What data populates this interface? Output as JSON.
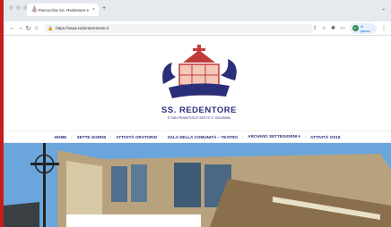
{
  "browser": {
    "tab_title": "Parrocchia SS. Redentore e S...",
    "tab_close": "×",
    "new_tab": "+",
    "url": "https://www.redentoresesto.it",
    "profile_initial": "P",
    "profile_status": "In pausa"
  },
  "site": {
    "title": "SS. REDENTORE",
    "subtitle": "E SAN FRANCESCO SESTO S. GIOVANNI"
  },
  "nav": {
    "items": [
      {
        "label": "HOME"
      },
      {
        "label": "SETTE GIORNI"
      },
      {
        "label": "ATTIVITÀ ORATORIO"
      },
      {
        "label": "SALA DELLA COMUNITÀ – TEATRO"
      },
      {
        "label": "ARCHIVIO SETTEGIORNI ▾"
      },
      {
        "label": "ATTIVITÀ OS18"
      }
    ],
    "separator": "/"
  },
  "colors": {
    "accent": "#2a2f7a",
    "border": "#c41e1e"
  }
}
